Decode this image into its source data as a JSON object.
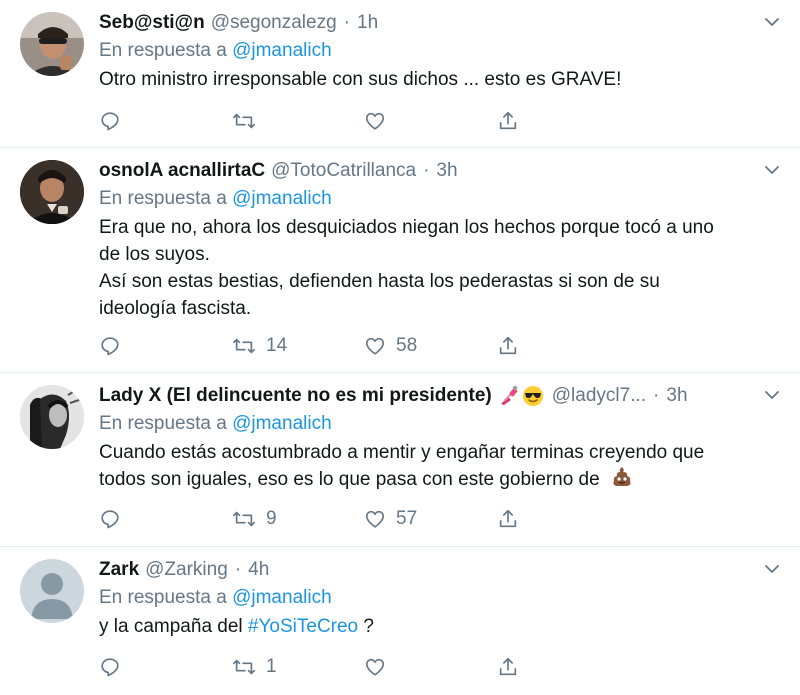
{
  "reply_prefix": "En respuesta a",
  "colors": {
    "link": "#1b95e0",
    "muted": "#657786",
    "text": "#14171a",
    "divider": "#e6ecf0"
  },
  "tweets": [
    {
      "name": "Seb@sti@n",
      "handle": "@segonzalezg",
      "dot": "·",
      "time": "1h",
      "reply_to": "@jmanalich",
      "text_lines": [
        "Otro ministro irresponsable con sus dichos ... esto es GRAVE!"
      ],
      "retweets": "",
      "likes": ""
    },
    {
      "name": "osnolA acnallirtaC",
      "handle": "@TotoCatrillanca",
      "dot": "·",
      "time": "3h",
      "reply_to": "@jmanalich",
      "text_lines": [
        "Era que no, ahora los desquiciados niegan los hechos porque tocó a uno",
        "de los suyos.",
        "Así son estas bestias, defienden hasta los pederastas si son de su",
        "ideología fascista."
      ],
      "retweets": "14",
      "likes": "58"
    },
    {
      "name": "Lady X (El delincuente no es mi presidente)",
      "name_emojis": [
        "nail-polish-emoji",
        "sunglasses-emoji"
      ],
      "handle": "@ladycl7...",
      "dot": "·",
      "time": "3h",
      "reply_to": "@jmanalich",
      "text_lines": [
        "Cuando estás acostumbrado a mentir y engañar terminas creyendo que",
        "todos son iguales, eso es lo que pasa con este gobierno de"
      ],
      "text_emoji": "pile-of-poo-emoji",
      "retweets": "9",
      "likes": "57"
    },
    {
      "name": "Zark",
      "handle": "@Zarking",
      "dot": "·",
      "time": "4h",
      "reply_to": "@jmanalich",
      "text_prefix": "y la campaña del ",
      "hashtag": "#YoSiTeCreo",
      "text_suffix": " ?",
      "retweets": "1",
      "likes": ""
    }
  ]
}
